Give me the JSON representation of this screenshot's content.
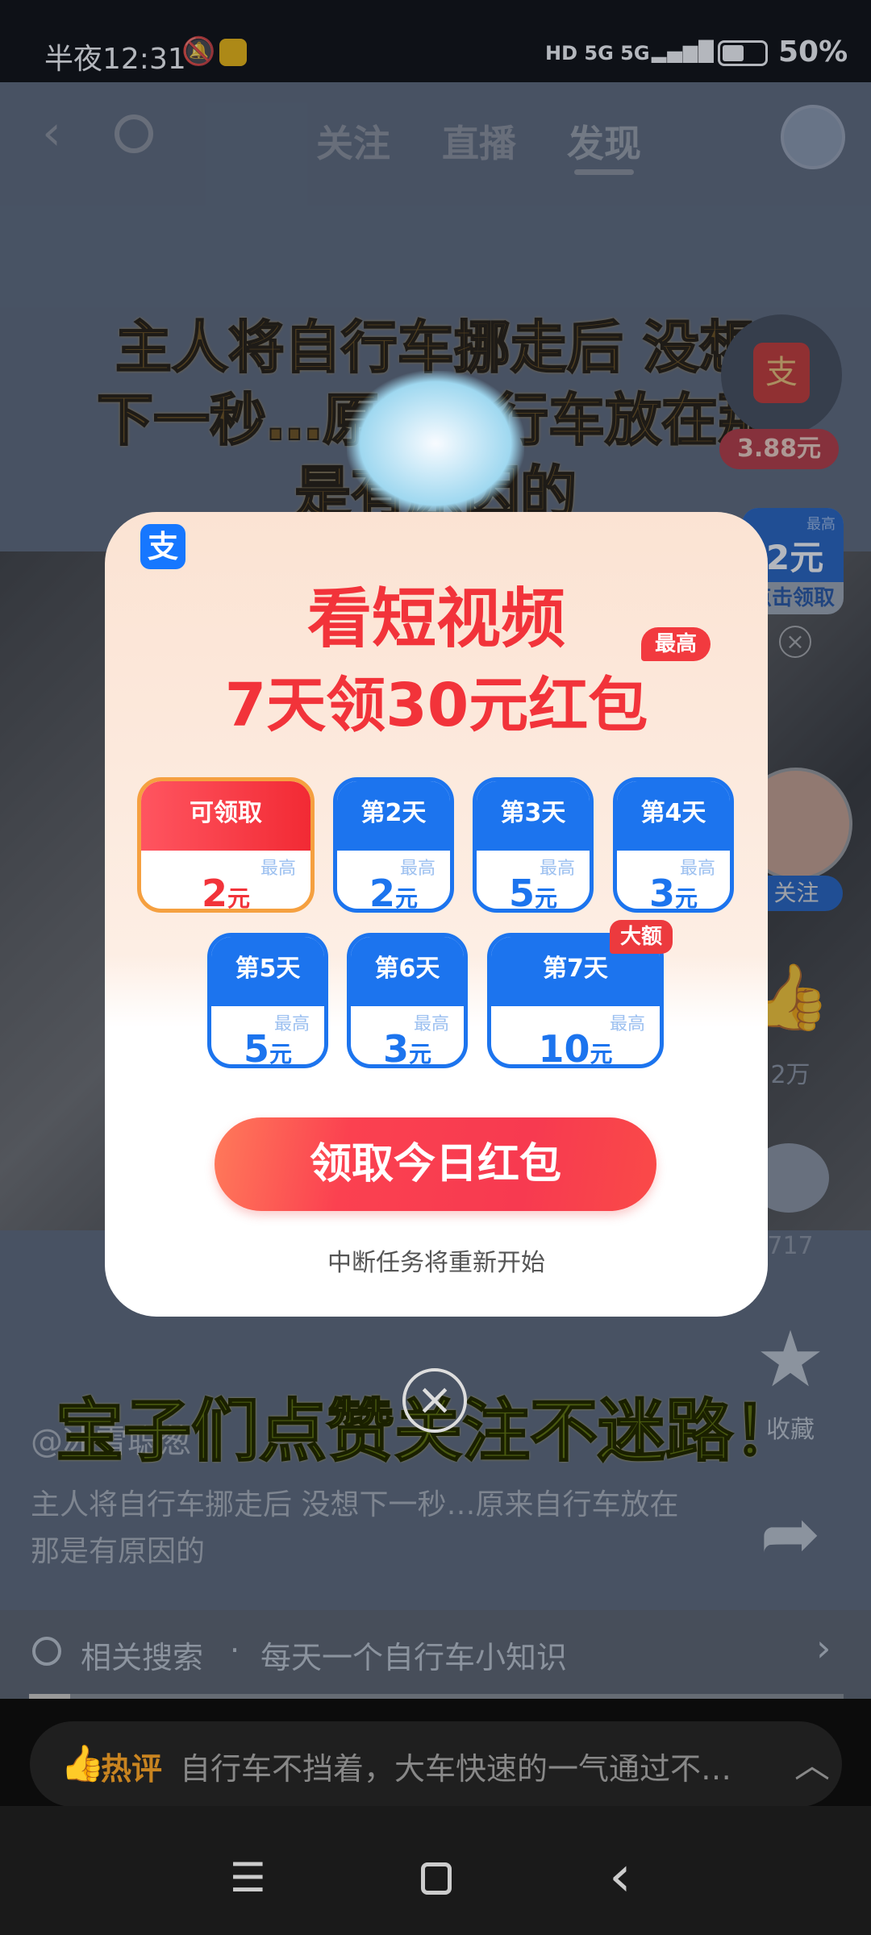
{
  "status": {
    "time": "半夜12:31",
    "network": "HD 5G 5G",
    "battery": "50%",
    "battery_level": 50
  },
  "nav": {
    "tabs": [
      {
        "label": "关注"
      },
      {
        "label": "直播"
      },
      {
        "label": "发现",
        "active": true
      }
    ]
  },
  "video": {
    "title_lines": [
      "主人将自行车挪走后 没想",
      "下一秒…原来自行车放在那",
      "是有原因的"
    ],
    "overlay_caption": "宝子们点赞关注不迷路！"
  },
  "side": {
    "red_packet_amount": "3.88元",
    "widget_max": "最高",
    "widget_amount": "2元",
    "widget_action": "点击领取",
    "follow": "关注",
    "likes": "2万",
    "comments": "717",
    "favorite": "收藏"
  },
  "author": {
    "name": "@冰雪聪葱",
    "description": "主人将自行车挪走后 没想下一秒…原来自行车放在那是有原因的"
  },
  "related": {
    "label": "相关搜索",
    "separator": "·",
    "query": "每天一个自行车小知识"
  },
  "hot_comment": {
    "tag": "热评",
    "text": "自行车不挡着，大车快速的一气通过不…"
  },
  "modal": {
    "logo": "支",
    "title_line1": "看短视频",
    "title_line2": "7天领30元红包",
    "title_badge": "最高",
    "days": [
      {
        "label": "可领取",
        "max": "最高",
        "amount": "2",
        "unit": "元",
        "active": true
      },
      {
        "label": "第2天",
        "max": "最高",
        "amount": "2",
        "unit": "元"
      },
      {
        "label": "第3天",
        "max": "最高",
        "amount": "5",
        "unit": "元"
      },
      {
        "label": "第4天",
        "max": "最高",
        "amount": "3",
        "unit": "元"
      },
      {
        "label": "第5天",
        "max": "最高",
        "amount": "5",
        "unit": "元"
      },
      {
        "label": "第6天",
        "max": "最高",
        "amount": "3",
        "unit": "元"
      },
      {
        "label": "第7天",
        "max": "最高",
        "amount": "10",
        "unit": "元",
        "badge": "大额"
      }
    ],
    "button": "领取今日红包",
    "footer": "中断任务将重新开始"
  },
  "colors": {
    "accent_red": "#f2333a",
    "accent_blue": "#1c74ee"
  }
}
